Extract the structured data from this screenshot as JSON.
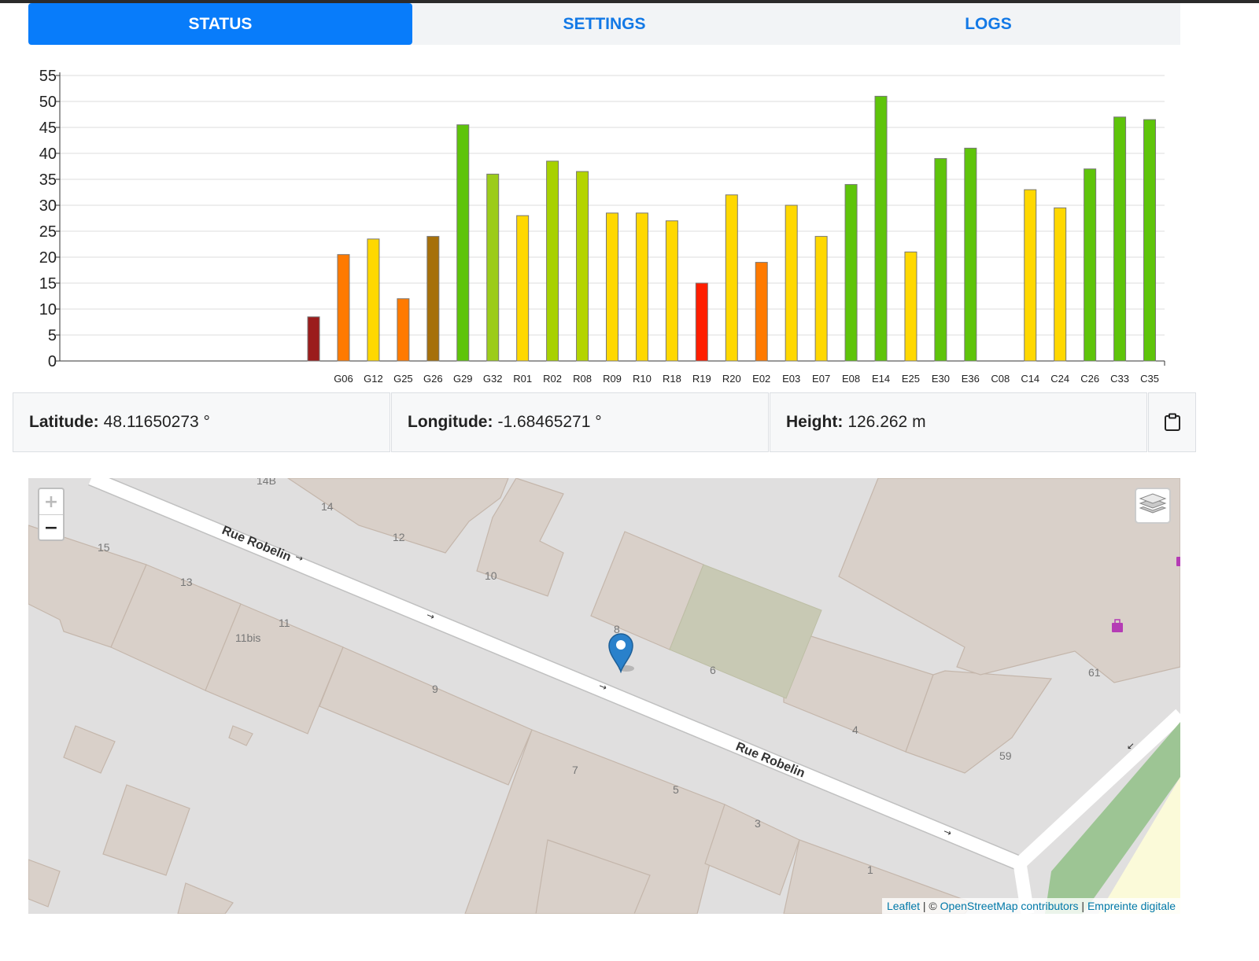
{
  "tabs": [
    {
      "label": "STATUS",
      "active": true
    },
    {
      "label": "SETTINGS",
      "active": false
    },
    {
      "label": "LOGS",
      "active": false
    }
  ],
  "chart_data": {
    "type": "bar",
    "title": "",
    "xlabel": "",
    "ylabel": "",
    "ylim": [
      0,
      55
    ],
    "yticks": [
      0,
      5,
      10,
      15,
      20,
      25,
      30,
      35,
      40,
      45,
      50,
      55
    ],
    "grid": true,
    "categories": [
      "",
      "",
      "",
      "",
      "",
      "",
      "",
      "",
      "",
      "G06",
      "G12",
      "G25",
      "G26",
      "G29",
      "G32",
      "R01",
      "R02",
      "R08",
      "R09",
      "R10",
      "R18",
      "R19",
      "R20",
      "E02",
      "E03",
      "E07",
      "E08",
      "E14",
      "E25",
      "E30",
      "E36",
      "C08",
      "C14",
      "C24",
      "C26",
      "C33",
      "C35"
    ],
    "values": [
      0,
      0,
      0,
      0,
      0,
      0,
      0,
      0,
      8.5,
      20.5,
      23.5,
      12,
      24,
      45.5,
      36,
      28,
      38.5,
      36.5,
      28.5,
      28.5,
      27,
      15,
      32,
      19,
      30,
      24,
      34,
      51,
      21,
      39,
      41,
      0,
      33,
      29.5,
      37,
      47,
      46.5
    ],
    "colors": [
      "#9b1c1c",
      "#9b1c1c",
      "#9b1c1c",
      "#9b1c1c",
      "#9b1c1c",
      "#9b1c1c",
      "#9b1c1c",
      "#9b1c1c",
      "#9b1c1c",
      "#ff7a00",
      "#ffd800",
      "#ff7a00",
      "#a6700a",
      "#5ec40a",
      "#9ccc1a",
      "#ffd800",
      "#a8d100",
      "#b4d400",
      "#ffd800",
      "#ffd800",
      "#ffd800",
      "#ff1e00",
      "#ffd800",
      "#ff7a00",
      "#ffd800",
      "#ffd800",
      "#5ec40a",
      "#5ec40a",
      "#ffd800",
      "#5ec40a",
      "#5ec40a",
      "#ffd800",
      "#ffd800",
      "#ffd800",
      "#5ec40a",
      "#5ec40a",
      "#5ec40a"
    ]
  },
  "position": {
    "latitude_label": "Latitude:",
    "latitude_value": "48.11650273 °",
    "longitude_label": "Longitude:",
    "longitude_value": "-1.68465271 °",
    "height_label": "Height:",
    "height_value": "126.262 m"
  },
  "map": {
    "zoom_in": "+",
    "zoom_out": "−",
    "street_labels": [
      "Rue Robelin",
      "Rue Robelin"
    ],
    "house_numbers": [
      "14B",
      "14",
      "12",
      "15",
      "13",
      "11",
      "11bis",
      "10",
      "8",
      "6",
      "9",
      "7",
      "5",
      "4",
      "3",
      "1",
      "61",
      "59"
    ],
    "attribution": {
      "leaflet": "Leaflet",
      "sep1": " | © ",
      "osm": "OpenStreetMap contributors",
      "sep2": " | ",
      "other": "Empreinte digitale"
    }
  }
}
